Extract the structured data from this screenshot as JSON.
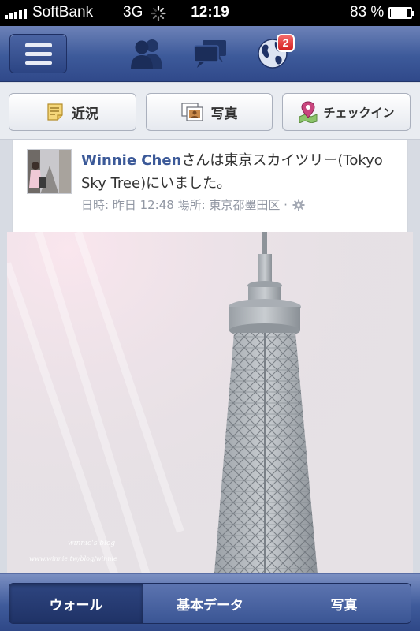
{
  "status_bar": {
    "carrier": "SoftBank",
    "network": "3G",
    "time": "12:19",
    "battery_percent": "83 %",
    "battery_level": 0.83
  },
  "navbar": {
    "menu_icon": "hamburger-menu-icon",
    "friend_requests_icon": "friends-icon",
    "messages_icon": "messages-icon",
    "notifications_icon": "globe-icon",
    "notification_count": "2"
  },
  "actions": {
    "status_label": "近況",
    "photo_label": "写真",
    "checkin_label": "チェックイン"
  },
  "story": {
    "actor_name": "Winnie Chen",
    "text": "さんは東京スカイツリー(Tokyo Sky Tree)にいました。",
    "meta": "日時: 昨日 12:48 場所: 東京都墨田区 ·",
    "photo_watermark_line1": "winnie's blog",
    "photo_watermark_line2": "www.winnie.tw/blog/winnie"
  },
  "tabs": [
    {
      "label": "ウォール",
      "active": true
    },
    {
      "label": "基本データ",
      "active": false
    },
    {
      "label": "写真",
      "active": false
    }
  ],
  "colors": {
    "brand_blue": "#3b5998",
    "badge_red": "#d41f1f",
    "meta_gray": "#9197a3"
  }
}
